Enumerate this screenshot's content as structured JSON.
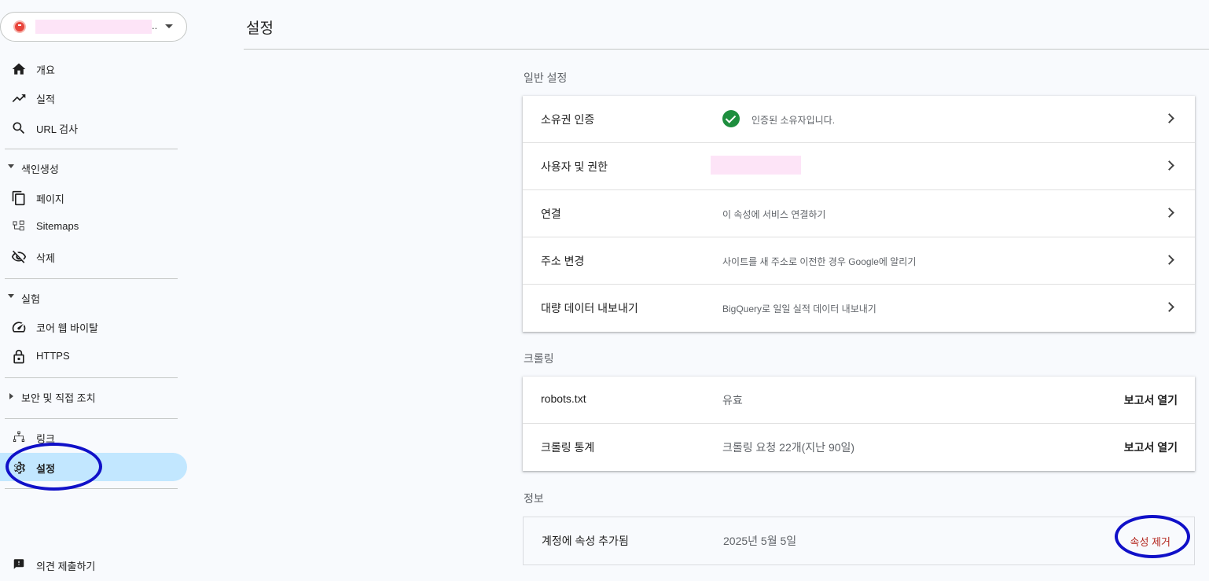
{
  "property": {
    "ellipsis": ".."
  },
  "nav": {
    "overview": "개요",
    "performance": "실적",
    "url_inspection": "URL 검사",
    "indexing_section": "색인생성",
    "pages": "페이지",
    "sitemaps": "Sitemaps",
    "removals": "삭제",
    "experience_section": "실험",
    "core_web_vitals": "코어 웹 바이탈",
    "https": "HTTPS",
    "security_section": "보안 및 직접 조치",
    "links": "링크",
    "settings": "설정",
    "feedback": "의견 제출하기"
  },
  "header": {
    "title": "설정"
  },
  "general": {
    "title": "일반 설정",
    "rows": [
      {
        "name": "소유권 인증",
        "value": "인증된 소유자입니다."
      },
      {
        "name": "사용자 및 권한",
        "value": ""
      },
      {
        "name": "연결",
        "value": "이 속성에 서비스 연결하기"
      },
      {
        "name": "주소 변경",
        "value": "사이트를 새 주소로 이전한 경우 Google에 알리기"
      },
      {
        "name": "대량 데이터 내보내기",
        "value": "BigQuery로 일일 실적 데이터 내보내기"
      }
    ]
  },
  "crawling": {
    "title": "크롤링",
    "rows": [
      {
        "name": "robots.txt",
        "value": "유효",
        "action": "보고서 열기"
      },
      {
        "name": "크롤링 통계",
        "value": "크롤링 요청 22개(지난 90일)",
        "action": "보고서 열기"
      }
    ]
  },
  "about": {
    "title": "정보",
    "rows": [
      {
        "name": "계정에 속성 추가됨",
        "value": "2025년 5월 5일",
        "action": "속성 제거"
      }
    ]
  },
  "colors": {
    "accent": "#c2e7ff",
    "annotation": "#1010c8",
    "success": "#1e8e3e",
    "danger": "#b3261e"
  }
}
